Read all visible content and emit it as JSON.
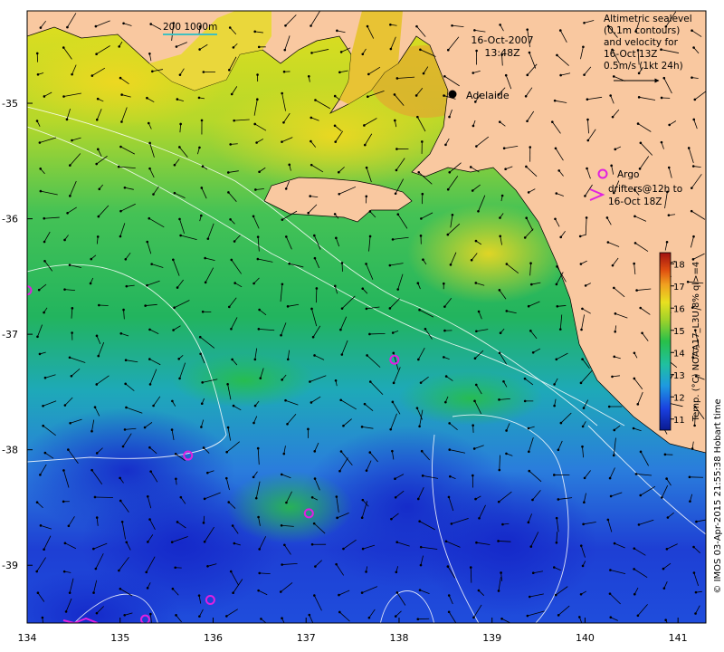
{
  "map": {
    "date": "16-Oct-2007",
    "time": "13:48Z",
    "city_label": "Adelaide",
    "scale_label": "200  1000m",
    "sealevel_legend": [
      "Altimetric sealevel",
      "(0.1m contours)",
      "and velocity for",
      "16-Oct 13Z",
      "0.5m/s (1kt 24h)"
    ],
    "argo_legend": [
      "Argo",
      "drifters@12h to",
      "16-Oct 18Z"
    ],
    "axis_x_ticks": [
      "134",
      "135",
      "136",
      "137",
      "138",
      "139",
      "140",
      "141"
    ],
    "axis_y_ticks": [
      "-35",
      "-36",
      "-37",
      "-38",
      "-39"
    ],
    "x_range": [
      134,
      141.3
    ],
    "y_range": [
      -39.5,
      -34.2
    ],
    "colorbar": {
      "title": "Temp. (°C) NOAA17_L3U 8% ql>=4",
      "ticks": [
        "11",
        "12",
        "13",
        "14",
        "15",
        "16",
        "17",
        "18"
      ],
      "range": [
        10.5,
        18.5
      ]
    },
    "credit": "© IMOS 03-Apr-2015 21:55:38 Hobart time",
    "colors": {
      "land": "#f9c8a0",
      "ocean_deep": "#1a2bd6",
      "ocean_mid": "#22c05a",
      "ocean_warm": "#e8e020",
      "argo": "#e020e0",
      "contour": "#ffffff"
    },
    "argo_floats": [
      {
        "lon": 134.0,
        "lat": -36.62
      },
      {
        "lon": 137.95,
        "lat": -37.22
      },
      {
        "lon": 135.73,
        "lat": -38.05
      },
      {
        "lon": 137.03,
        "lat": -38.55
      },
      {
        "lon": 135.97,
        "lat": -39.3
      },
      {
        "lon": 135.27,
        "lat": -39.47
      }
    ]
  }
}
